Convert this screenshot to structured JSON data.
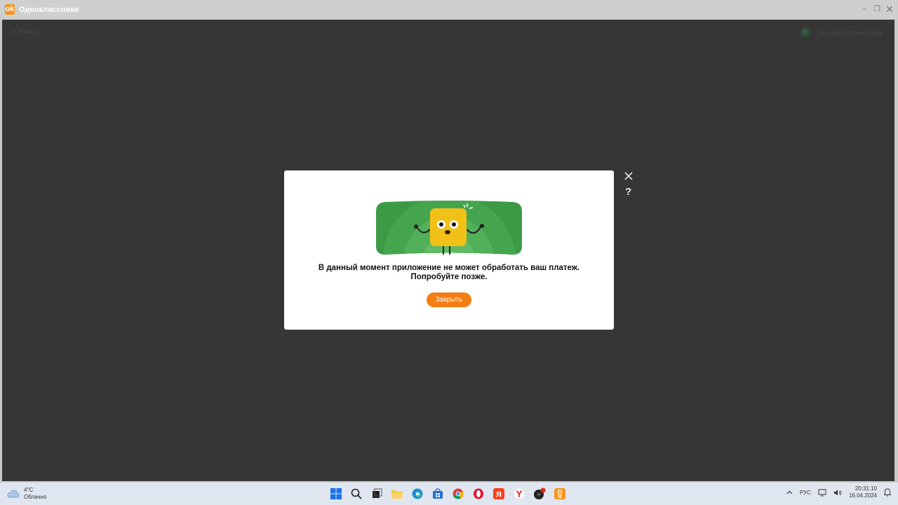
{
  "window": {
    "title": "Одноклассники",
    "back_label": "Назад",
    "user_name": "Оксана Богомолова"
  },
  "dialog": {
    "message": "В данный момент приложение не может обработать ваш платеж. Попробуйте позже.",
    "button_label": "Закрыть",
    "help_label": "?"
  },
  "taskbar": {
    "weather_temp": "4°C",
    "weather_desc": "Облачно",
    "language": "РУС",
    "time": "20:31:10",
    "date": "16.04.2024",
    "apps": [
      "start",
      "search",
      "task-view",
      "file-explorer",
      "edge",
      "store",
      "chrome",
      "opera",
      "yandex",
      "yandex-browser",
      "media-player",
      "odnoklassniki"
    ]
  },
  "colors": {
    "accent": "#f47d14",
    "banner_green": "#3c9a45",
    "mascot_yellow": "#f2c118"
  }
}
